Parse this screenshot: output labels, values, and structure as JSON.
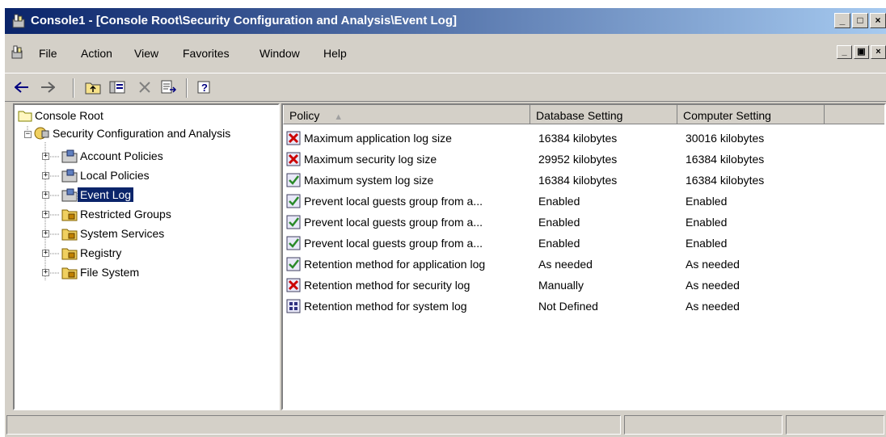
{
  "window": {
    "title": "Console1 - [Console Root\\Security Configuration and Analysis\\Event Log]"
  },
  "menu": {
    "items": [
      "File",
      "Action",
      "View",
      "Favorites",
      "Window",
      "Help"
    ]
  },
  "toolbar": {
    "buttons": [
      "back-icon",
      "forward-icon",
      "up-folder-icon",
      "show-hide-tree-icon",
      "delete-icon",
      "export-list-icon",
      "help-icon"
    ]
  },
  "tree": {
    "root": "Console Root",
    "sca": "Security Configuration and Analysis",
    "children": [
      "Account Policies",
      "Local Policies",
      "Event Log",
      "Restricted Groups",
      "System Services",
      "Registry",
      "File System"
    ],
    "selected": "Event Log"
  },
  "list": {
    "columns": [
      "Policy",
      "Database Setting",
      "Computer Setting"
    ],
    "rows": [
      {
        "policy": "Maximum application log size",
        "db": "16384 kilobytes",
        "computer": "30016 kilobytes",
        "status": "mismatch"
      },
      {
        "policy": "Maximum security log size",
        "db": "29952 kilobytes",
        "computer": "16384 kilobytes",
        "status": "mismatch"
      },
      {
        "policy": "Maximum system log size",
        "db": "16384 kilobytes",
        "computer": "16384 kilobytes",
        "status": "match"
      },
      {
        "policy": "Prevent local guests group from a...",
        "db": "Enabled",
        "computer": "Enabled",
        "status": "match"
      },
      {
        "policy": "Prevent local guests group from a...",
        "db": "Enabled",
        "computer": "Enabled",
        "status": "match"
      },
      {
        "policy": "Prevent local guests group from a...",
        "db": "Enabled",
        "computer": "Enabled",
        "status": "match"
      },
      {
        "policy": "Retention method for application log",
        "db": "As needed",
        "computer": "As needed",
        "status": "match"
      },
      {
        "policy": "Retention method for security log",
        "db": "Manually",
        "computer": "As needed",
        "status": "mismatch"
      },
      {
        "policy": "Retention method for system log",
        "db": "Not Defined",
        "computer": "As needed",
        "status": "undefined"
      }
    ]
  },
  "colors": {
    "titlebar_start": "#0a246a",
    "titlebar_end": "#a6caf0",
    "selection": "#0a246a",
    "mismatch": "#cc0000",
    "match": "#2a8a2a"
  }
}
